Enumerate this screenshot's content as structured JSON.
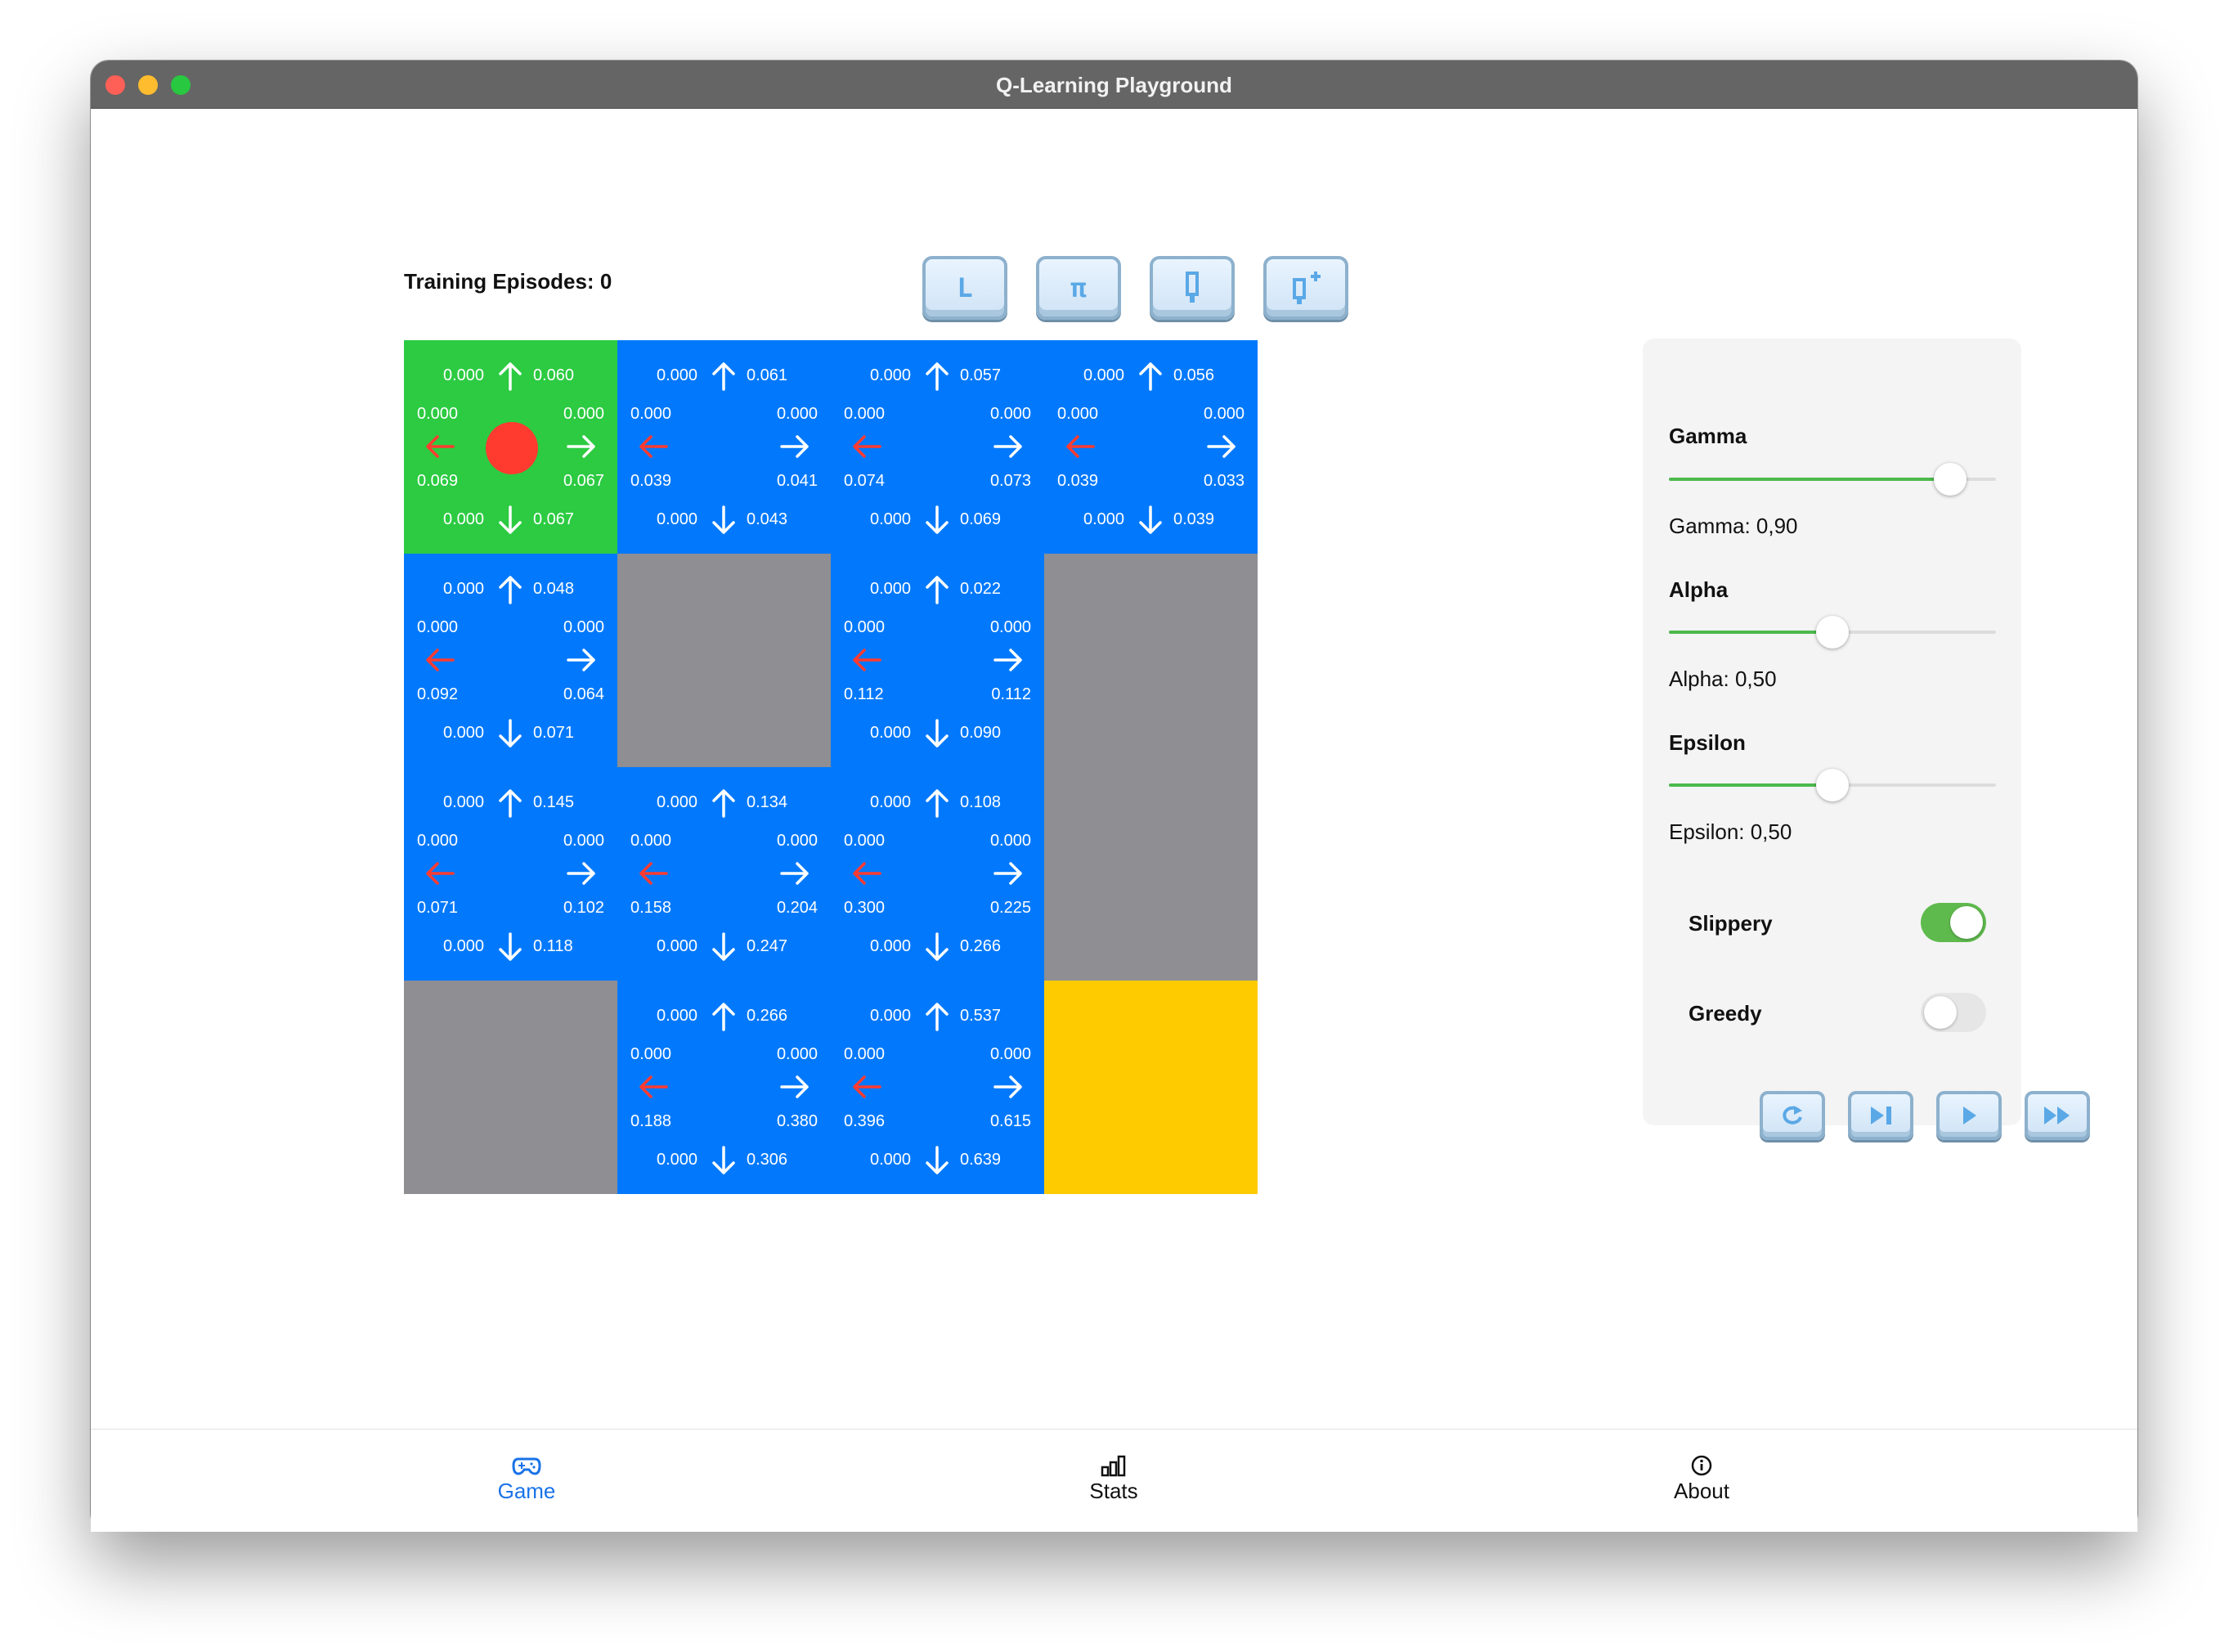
{
  "window": {
    "title": "Q-Learning Playground"
  },
  "training": {
    "label": "Training Episodes: 0"
  },
  "toolbar_buttons": [
    {
      "name": "tool-l-button",
      "glyph": "L"
    },
    {
      "name": "tool-pi-button",
      "glyph": "π"
    },
    {
      "name": "tool-quill-button",
      "glyph": "pencil-icon"
    },
    {
      "name": "tool-quill-plus-button",
      "glyph": "pencil-plus-icon"
    }
  ],
  "grid": {
    "rows": 4,
    "cols": 4,
    "cells": [
      {
        "type": "start",
        "agent": true,
        "q": {
          "up": [
            "0.000",
            "0.060"
          ],
          "left": [
            "0.000",
            "0.069"
          ],
          "right": [
            "0.000",
            "0.067"
          ],
          "down": [
            "0.000",
            "0.067"
          ]
        }
      },
      {
        "type": "blue",
        "q": {
          "up": [
            "0.000",
            "0.061"
          ],
          "left": [
            "0.000",
            "0.039"
          ],
          "right": [
            "0.000",
            "0.041"
          ],
          "down": [
            "0.000",
            "0.043"
          ]
        }
      },
      {
        "type": "blue",
        "q": {
          "up": [
            "0.000",
            "0.057"
          ],
          "left": [
            "0.000",
            "0.074"
          ],
          "right": [
            "0.000",
            "0.073"
          ],
          "down": [
            "0.000",
            "0.069"
          ]
        }
      },
      {
        "type": "blue",
        "q": {
          "up": [
            "0.000",
            "0.056"
          ],
          "left": [
            "0.000",
            "0.039"
          ],
          "right": [
            "0.000",
            "0.033"
          ],
          "down": [
            "0.000",
            "0.039"
          ]
        }
      },
      {
        "type": "blue",
        "q": {
          "up": [
            "0.000",
            "0.048"
          ],
          "left": [
            "0.000",
            "0.092"
          ],
          "right": [
            "0.000",
            "0.064"
          ],
          "down": [
            "0.000",
            "0.071"
          ]
        }
      },
      {
        "type": "wall"
      },
      {
        "type": "blue",
        "q": {
          "up": [
            "0.000",
            "0.022"
          ],
          "left": [
            "0.000",
            "0.112"
          ],
          "right": [
            "0.000",
            "0.112"
          ],
          "down": [
            "0.000",
            "0.090"
          ]
        }
      },
      {
        "type": "wall"
      },
      {
        "type": "blue",
        "q": {
          "up": [
            "0.000",
            "0.145"
          ],
          "left": [
            "0.000",
            "0.071"
          ],
          "right": [
            "0.000",
            "0.102"
          ],
          "down": [
            "0.000",
            "0.118"
          ]
        }
      },
      {
        "type": "blue",
        "q": {
          "up": [
            "0.000",
            "0.134"
          ],
          "left": [
            "0.000",
            "0.158"
          ],
          "right": [
            "0.000",
            "0.204"
          ],
          "down": [
            "0.000",
            "0.247"
          ]
        }
      },
      {
        "type": "blue",
        "q": {
          "up": [
            "0.000",
            "0.108"
          ],
          "left": [
            "0.000",
            "0.300"
          ],
          "right": [
            "0.000",
            "0.225"
          ],
          "down": [
            "0.000",
            "0.266"
          ]
        }
      },
      {
        "type": "wall"
      },
      {
        "type": "wall"
      },
      {
        "type": "blue",
        "q": {
          "up": [
            "0.000",
            "0.266"
          ],
          "left": [
            "0.000",
            "0.188"
          ],
          "right": [
            "0.000",
            "0.380"
          ],
          "down": [
            "0.000",
            "0.306"
          ]
        }
      },
      {
        "type": "blue",
        "q": {
          "up": [
            "0.000",
            "0.537"
          ],
          "left": [
            "0.000",
            "0.396"
          ],
          "right": [
            "0.000",
            "0.615"
          ],
          "down": [
            "0.000",
            "0.639"
          ]
        }
      },
      {
        "type": "goal"
      }
    ]
  },
  "panel": {
    "gamma": {
      "label": "Gamma",
      "value_text": "Gamma: 0,90",
      "value": 0.9
    },
    "alpha": {
      "label": "Alpha",
      "value_text": "Alpha: 0,50",
      "value": 0.5
    },
    "epsilon": {
      "label": "Epsilon",
      "value_text": "Epsilon: 0,50",
      "value": 0.5
    },
    "slippery": {
      "label": "Slippery",
      "on": true
    },
    "greedy": {
      "label": "Greedy",
      "on": false
    },
    "controls": [
      {
        "name": "reset-button",
        "icon": "reset-icon"
      },
      {
        "name": "step-button",
        "icon": "step-forward-icon"
      },
      {
        "name": "play-button",
        "icon": "play-icon"
      },
      {
        "name": "fast-forward-button",
        "icon": "fast-forward-icon"
      }
    ]
  },
  "tabs": [
    {
      "label": "Game",
      "icon": "gamecontroller-icon",
      "active": true
    },
    {
      "label": "Stats",
      "icon": "chart-bar-icon",
      "active": false
    },
    {
      "label": "About",
      "icon": "info-circle-icon",
      "active": false
    }
  ],
  "colors": {
    "cell_blue": "#0279fd",
    "cell_start": "#2ccb42",
    "cell_wall": "#8e8e93",
    "cell_goal": "#fecb00",
    "agent": "#ff3b30",
    "left_arrow": "#ff3b30",
    "slider_fill": "#4cb94c",
    "tab_active": "#1a73e8"
  }
}
